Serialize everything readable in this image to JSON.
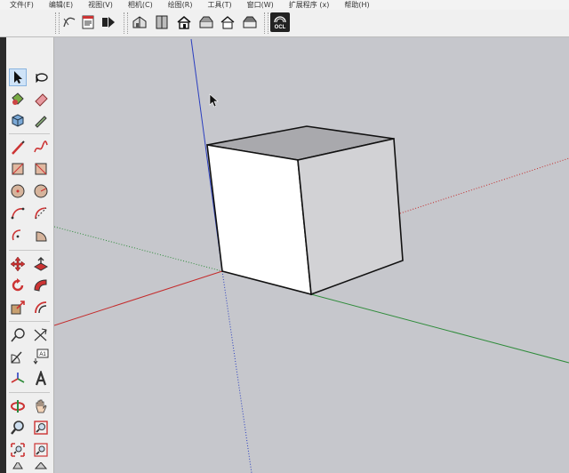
{
  "menu": {
    "items": [
      {
        "label": "文件(F)"
      },
      {
        "label": "编辑(E)"
      },
      {
        "label": "视图(V)"
      },
      {
        "label": "相机(C)"
      },
      {
        "label": "绘图(R)"
      },
      {
        "label": "工具(T)"
      },
      {
        "label": "窗口(W)"
      },
      {
        "label": "扩展程序 (x)"
      },
      {
        "label": "帮助(H)"
      }
    ]
  },
  "toolbar": {
    "ocl_label": "OCL"
  },
  "sidebar": {
    "text_tool_label": "A1"
  },
  "colors": {
    "axis_red": "#c42b2b",
    "axis_green": "#2e8b3a",
    "axis_blue": "#2b3fbf",
    "background": "#c6c7cc"
  }
}
